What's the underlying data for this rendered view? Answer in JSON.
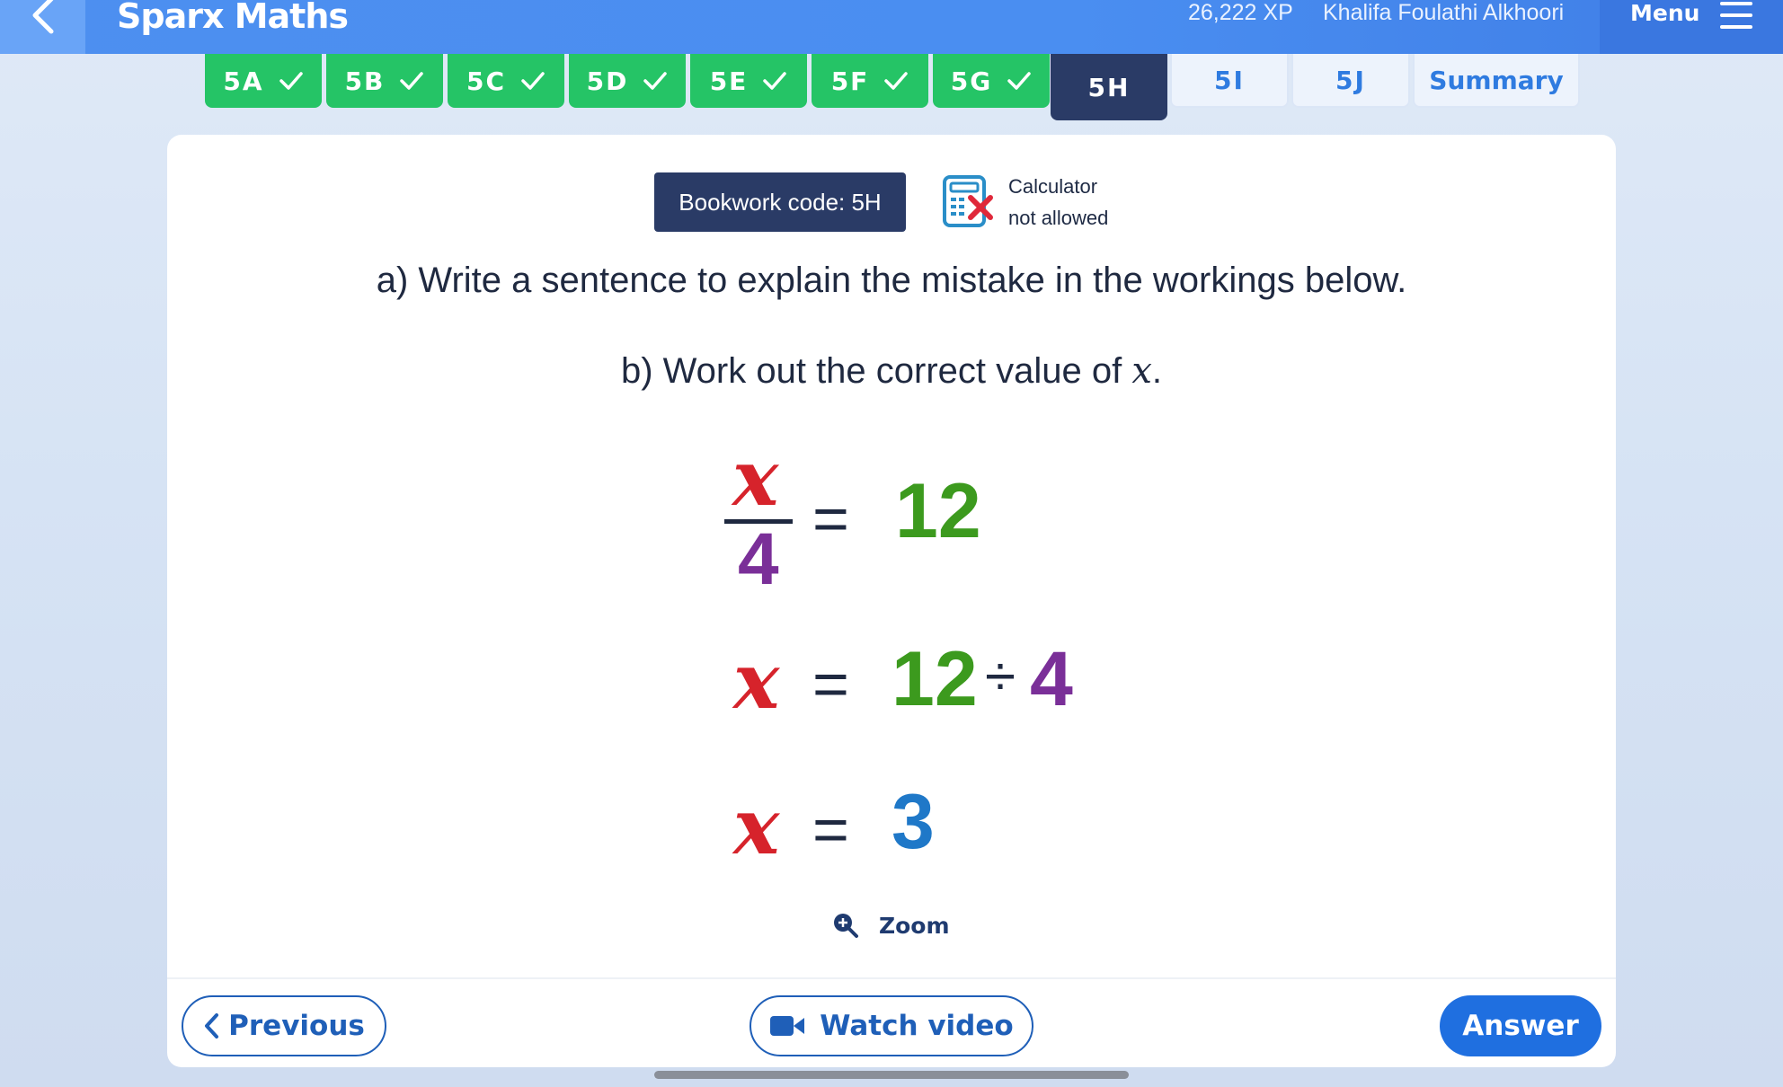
{
  "header": {
    "app_title": "Sparx Maths",
    "xp": "26,222 XP",
    "username": "Khalifa Foulathi Alkhoori",
    "menu_label": "Menu"
  },
  "tabs": [
    {
      "label": "5A",
      "state": "done"
    },
    {
      "label": "5B",
      "state": "done"
    },
    {
      "label": "5C",
      "state": "done"
    },
    {
      "label": "5D",
      "state": "done"
    },
    {
      "label": "5E",
      "state": "done"
    },
    {
      "label": "5F",
      "state": "done"
    },
    {
      "label": "5G",
      "state": "done"
    },
    {
      "label": "5H",
      "state": "active"
    },
    {
      "label": "5I",
      "state": "todo"
    },
    {
      "label": "5J",
      "state": "todo"
    },
    {
      "label": "Summary",
      "state": "todo"
    }
  ],
  "question": {
    "bookwork_code": "Bookwork code: 5H",
    "calculator_line1": "Calculator",
    "calculator_line2": "not allowed",
    "part_a": "a) Write a sentence to explain the mistake in the workings below.",
    "part_b_prefix": "b) Work out the correct value of ",
    "part_b_var": "x",
    "part_b_suffix": ".",
    "workings": {
      "line1": {
        "numerator": "x",
        "denominator": "4",
        "equals": "=",
        "rhs": "12"
      },
      "line2": {
        "lhs": "x",
        "equals": "=",
        "a": "12",
        "op": "÷",
        "b": "4"
      },
      "line3": {
        "lhs": "x",
        "equals": "=",
        "rhs": "3"
      }
    },
    "zoom_label": "Zoom"
  },
  "footer": {
    "previous_label": "Previous",
    "watch_video_label": "Watch video",
    "answer_label": "Answer"
  },
  "colors": {
    "variable": "#d6232b",
    "twelve": "#3c9a1e",
    "four": "#7a2f98",
    "result": "#1f78c8",
    "done_tab": "#25c466",
    "active_tab": "#2a3b66",
    "primary": "#1f6fe0"
  },
  "icons": [
    "back-chevron-icon",
    "hamburger-icon",
    "check-icon",
    "calculator-not-allowed-icon",
    "zoom-in-icon",
    "chevron-left-icon",
    "video-camera-icon"
  ]
}
